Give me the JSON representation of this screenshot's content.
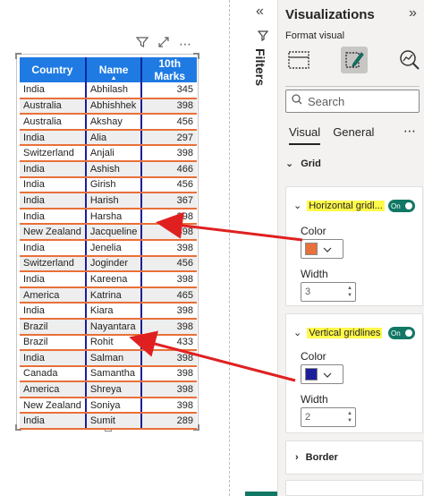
{
  "table": {
    "headers": [
      "Country",
      "Name",
      "10th Marks"
    ],
    "rows": [
      [
        "India",
        "Abhilash",
        "345"
      ],
      [
        "Australia",
        "Abhishhek",
        "398"
      ],
      [
        "Australia",
        "Akshay",
        "456"
      ],
      [
        "India",
        "Alia",
        "297"
      ],
      [
        "Switzerland",
        "Anjali",
        "398"
      ],
      [
        "India",
        "Ashish",
        "466"
      ],
      [
        "India",
        "Girish",
        "456"
      ],
      [
        "India",
        "Harish",
        "367"
      ],
      [
        "India",
        "Harsha",
        "398"
      ],
      [
        "New Zealand",
        "Jacqueline",
        "398"
      ],
      [
        "India",
        "Jenelia",
        "398"
      ],
      [
        "Switzerland",
        "Joginder",
        "456"
      ],
      [
        "India",
        "Kareena",
        "398"
      ],
      [
        "America",
        "Katrina",
        "465"
      ],
      [
        "India",
        "Kiara",
        "398"
      ],
      [
        "Brazil",
        "Nayantara",
        "398"
      ],
      [
        "Brazil",
        "Rohit",
        "433"
      ],
      [
        "India",
        "Salman",
        "398"
      ],
      [
        "Canada",
        "Samantha",
        "398"
      ],
      [
        "America",
        "Shreya",
        "398"
      ],
      [
        "New Zealand",
        "Soniya",
        "398"
      ],
      [
        "India",
        "Sumit",
        "289"
      ]
    ]
  },
  "filters_label": "Filters",
  "pane": {
    "title": "Visualizations",
    "subtitle": "Format visual",
    "search_placeholder": "Search",
    "tab_visual": "Visual",
    "tab_general": "General",
    "section_grid": "Grid",
    "horizontal": {
      "label": "Horizontal gridl...",
      "toggle": "On",
      "color_label": "Color",
      "color": "#e8703a",
      "width_label": "Width",
      "width_value": "3"
    },
    "vertical": {
      "label": "Vertical gridlines",
      "toggle": "On",
      "color_label": "Color",
      "color": "#1b1f99",
      "width_label": "Width",
      "width_value": "2"
    },
    "section_border": "Border"
  },
  "colors": {
    "header_bg": "#1f7be3",
    "accent": "#117865",
    "arrow": "#e02020",
    "highlight": "#fff94a"
  }
}
